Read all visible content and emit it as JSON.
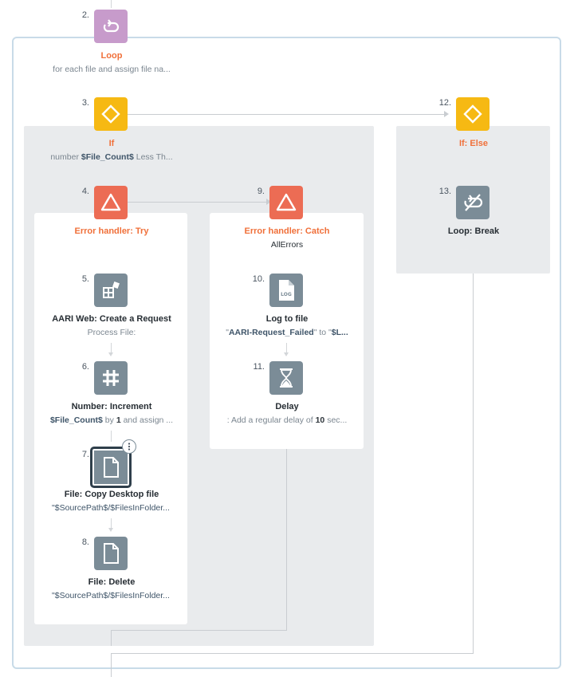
{
  "steps": {
    "loop": {
      "num": "2.",
      "title": "Loop",
      "desc": "for each file and assign file na..."
    },
    "if": {
      "num": "3.",
      "title": "If",
      "desc_prefix": "number ",
      "desc_var": "$File_Count$",
      "desc_suffix": " Less Th..."
    },
    "try": {
      "num": "4.",
      "title": "Error handler: Try"
    },
    "aari": {
      "num": "5.",
      "title": "AARI Web: Create a Request",
      "desc": "Process File:"
    },
    "increment": {
      "num": "6.",
      "title": "Number: Increment",
      "desc_var": "$File_Count$",
      "desc_by": " by ",
      "desc_val": "1",
      "desc_suffix": " and assign ..."
    },
    "copy": {
      "num": "7.",
      "title": "File: Copy Desktop file",
      "desc": "\"$SourcePath$/$FilesInFolder..."
    },
    "delete": {
      "num": "8.",
      "title": "File: Delete",
      "desc": "\"$SourcePath$/$FilesInFolder..."
    },
    "catch": {
      "num": "9.",
      "title": "Error handler: Catch",
      "subtitle": "AllErrors"
    },
    "log": {
      "num": "10.",
      "title": "Log to file",
      "desc_q1": "\"",
      "desc_var1": "AARI-Request_Failed",
      "desc_mid": "\" to \"",
      "desc_var2": "$L..."
    },
    "delay": {
      "num": "11.",
      "title": "Delay",
      "desc_prefix": ": Add a regular delay of ",
      "desc_val": "10",
      "desc_suffix": " sec..."
    },
    "else": {
      "num": "12.",
      "title": "If: Else"
    },
    "break": {
      "num": "13.",
      "title": "Loop: Break"
    }
  },
  "icons": {
    "loop": "loop-icon",
    "if": "diamond-icon",
    "try": "warning-triangle-icon",
    "catch": "warning-triangle-icon",
    "aari": "aari-web-icon",
    "increment": "hash-icon",
    "copy": "file-icon",
    "delete": "file-icon",
    "log": "log-file-icon",
    "delay": "hourglass-icon",
    "else": "diamond-icon",
    "break": "loop-break-icon",
    "menu": "more-vertical-icon"
  },
  "colors": {
    "loop": "#c79bcb",
    "if": "#f6b913",
    "error": "#ec6c54",
    "action": "#7b8c97",
    "title_orange": "#f0703a",
    "frame": "#c8dbe8"
  }
}
